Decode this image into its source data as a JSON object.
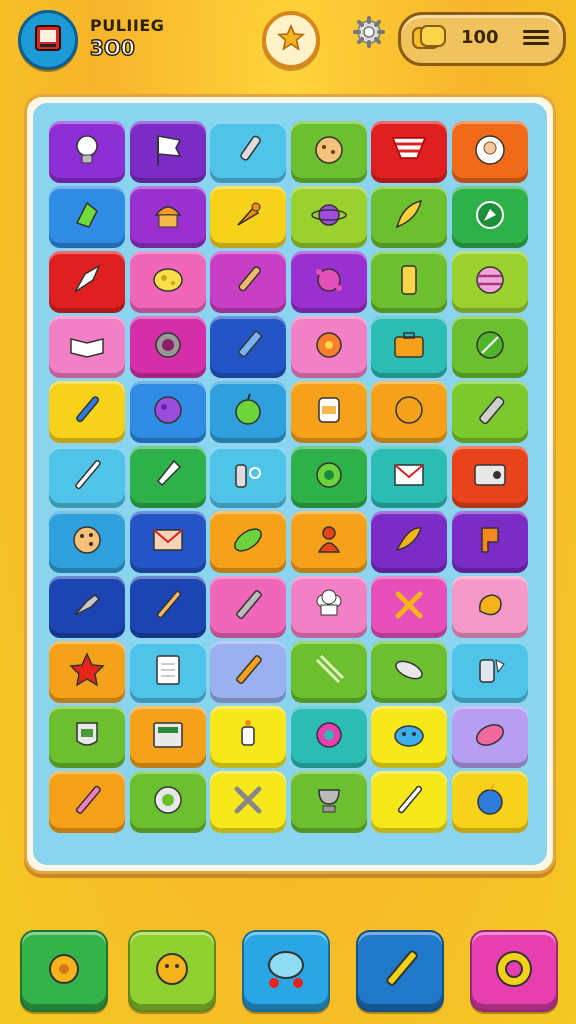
{
  "hud": {
    "player_name": "PULIIEG",
    "player_score": "3O0",
    "coin_count": "100",
    "icons": [
      "avatar-icon",
      "star-badge-icon",
      "settings-gear-icon",
      "coin-stack-icon",
      "menu-icon"
    ]
  },
  "grid": {
    "rows": 11,
    "cols": 6,
    "tiles": [
      {
        "color": "#8e2fd6",
        "icon": "lightbulb"
      },
      {
        "color": "#7b2cc7",
        "icon": "flag"
      },
      {
        "color": "#4fc3e8",
        "icon": "pen"
      },
      {
        "color": "#6cc02f",
        "icon": "cookie"
      },
      {
        "color": "#e02020",
        "icon": "striped-banner"
      },
      {
        "color": "#f06a1a",
        "icon": "portrait"
      },
      {
        "color": "#2f8be3",
        "icon": "leaf-gem"
      },
      {
        "color": "#9a30d0",
        "icon": "cupcake"
      },
      {
        "color": "#f7d21b",
        "icon": "carrot"
      },
      {
        "color": "#9bd12e",
        "icon": "planet"
      },
      {
        "color": "#6cc02f",
        "icon": "feather"
      },
      {
        "color": "#2fb14a",
        "icon": "compass"
      },
      {
        "color": "#e02020",
        "icon": "arrowhead"
      },
      {
        "color": "#f066b8",
        "icon": "cheese"
      },
      {
        "color": "#c83fc6",
        "icon": "brush"
      },
      {
        "color": "#9a30d0",
        "icon": "splat"
      },
      {
        "color": "#6cc02f",
        "icon": "battery"
      },
      {
        "color": "#9bd12e",
        "icon": "striped-ball"
      },
      {
        "color": "#f37fc5",
        "icon": "book"
      },
      {
        "color": "#d42ea8",
        "icon": "gear"
      },
      {
        "color": "#2455c7",
        "icon": "crayon"
      },
      {
        "color": "#f37fc5",
        "icon": "flower"
      },
      {
        "color": "#2bbcb4",
        "icon": "briefcase"
      },
      {
        "color": "#6cc02f",
        "icon": "leaf"
      },
      {
        "color": "#f7d21b",
        "icon": "wand"
      },
      {
        "color": "#2f8be3",
        "icon": "blob"
      },
      {
        "color": "#2fa0dc",
        "icon": "lime"
      },
      {
        "color": "#f5a11a",
        "icon": "jar"
      },
      {
        "color": "#f5a11a",
        "icon": "orange"
      },
      {
        "color": "#7cc92e",
        "icon": "flashlight"
      },
      {
        "color": "#4fc3e8",
        "icon": "knife"
      },
      {
        "color": "#2fb14a",
        "icon": "shovel"
      },
      {
        "color": "#4fc3e8",
        "icon": "key"
      },
      {
        "color": "#2fb14a",
        "icon": "ring-gear"
      },
      {
        "color": "#2bbcb4",
        "icon": "envelope"
      },
      {
        "color": "#e8431a",
        "icon": "radio"
      },
      {
        "color": "#2fa0dc",
        "icon": "choc-cookie"
      },
      {
        "color": "#2455c7",
        "icon": "mail"
      },
      {
        "color": "#f5a11a",
        "icon": "pickle"
      },
      {
        "color": "#f5a11a",
        "icon": "pawn"
      },
      {
        "color": "#7b2cc7",
        "icon": "sprout"
      },
      {
        "color": "#7b2cc7",
        "icon": "p-sign"
      },
      {
        "color": "#1c45b3",
        "icon": "drill"
      },
      {
        "color": "#1c45b3",
        "icon": "paintbrush"
      },
      {
        "color": "#f066b8",
        "icon": "pencil"
      },
      {
        "color": "#f37fc5",
        "icon": "chef-hat"
      },
      {
        "color": "#e64fb9",
        "icon": "cross-tools"
      },
      {
        "color": "#f59ac8",
        "icon": "yellow-blob"
      },
      {
        "color": "#f5a11a",
        "icon": "red-star"
      },
      {
        "color": "#4fc3e8",
        "icon": "notepad"
      },
      {
        "color": "#9ab0ef",
        "icon": "pen-orange"
      },
      {
        "color": "#6cc02f",
        "icon": "chopsticks"
      },
      {
        "color": "#6cc02f",
        "icon": "fish"
      },
      {
        "color": "#4fc3e8",
        "icon": "can"
      },
      {
        "color": "#6cc02f",
        "icon": "shield-jar"
      },
      {
        "color": "#f5a11a",
        "icon": "register"
      },
      {
        "color": "#f7e81b",
        "icon": "robot"
      },
      {
        "color": "#2bbcb4",
        "icon": "donut"
      },
      {
        "color": "#f7e81b",
        "icon": "blue-blob"
      },
      {
        "color": "#b69ff2",
        "icon": "pink-bean"
      },
      {
        "color": "#f5a11a",
        "icon": "pink-marker"
      },
      {
        "color": "#6cc02f",
        "icon": "cog-ring"
      },
      {
        "color": "#f7e81b",
        "icon": "x-sticks"
      },
      {
        "color": "#6cc02f",
        "icon": "trophy-bowl"
      },
      {
        "color": "#f7e81b",
        "icon": "dagger"
      },
      {
        "color": "#f7d21b",
        "icon": "blue-berry"
      }
    ]
  },
  "toolbar": {
    "buttons": [
      {
        "color": "#34b34a",
        "icon": "gear-sun"
      },
      {
        "color": "#8fd12f",
        "icon": "sun-face"
      },
      {
        "color": "#29a6e3",
        "icon": "bubble-cherries"
      },
      {
        "color": "#1f79c8",
        "icon": "rocket-pencil"
      },
      {
        "color": "#e83fb0",
        "icon": "donut-ring"
      }
    ]
  }
}
